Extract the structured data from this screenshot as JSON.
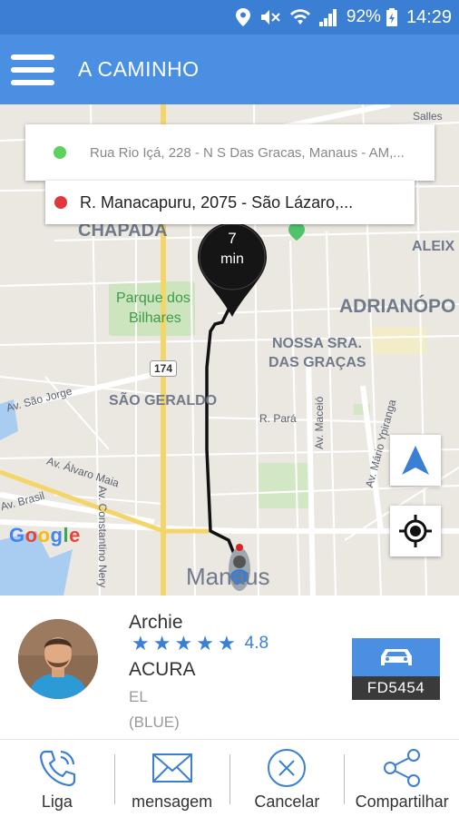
{
  "status_bar": {
    "battery": "92%",
    "time": "14:29"
  },
  "app_bar": {
    "title": "A CAMINHO"
  },
  "trip": {
    "pickup_address": "Rua Rio Içá, 228 - N S Das Gracas, Manaus - AM,...",
    "dropoff_address": "R. Manacapuru, 2075 - São Lázaro,...",
    "eta_value": "7",
    "eta_unit": "min"
  },
  "map": {
    "labels": {
      "chapada": "CHAPADA",
      "aleix": "ALEIX",
      "adrianopolis": "ADRIANÓPO",
      "parque_1": "Parque dos",
      "parque_2": "Bilhares",
      "nossa_sra_1": "NOSSA SRA.",
      "nossa_sra_2": "DAS GRAÇAS",
      "sao_geraldo": "SÃO GERALDO",
      "route_174": "174",
      "av_sao_jorge": "Av. São Jorge",
      "r_para": "R. Pará",
      "av_constantino": "Av. Constantino Nery",
      "av_maceio": "Av. Maceió",
      "av_mario": "Av. Mário Ypiranga",
      "av_alvaro": "Av. Álvaro Maia",
      "av_brasil": "Av. Brasil",
      "salles": "Salles",
      "manaus": "Manaus"
    },
    "logo": "Google"
  },
  "driver": {
    "name": "Archie",
    "rating": "4.8",
    "stars": 5,
    "car_make": "ACURA",
    "car_model": "EL",
    "car_color": "(BLUE)",
    "plate": "FD5454"
  },
  "actions": {
    "call": "Liga",
    "message": "mensagem",
    "cancel": "Cancelar",
    "share": "Compartilhar"
  },
  "colors": {
    "primary": "#4a8fe2",
    "status_bar": "#3b7fd4",
    "pickup_dot": "#5cd35c",
    "dropoff_dot": "#e0383b"
  }
}
